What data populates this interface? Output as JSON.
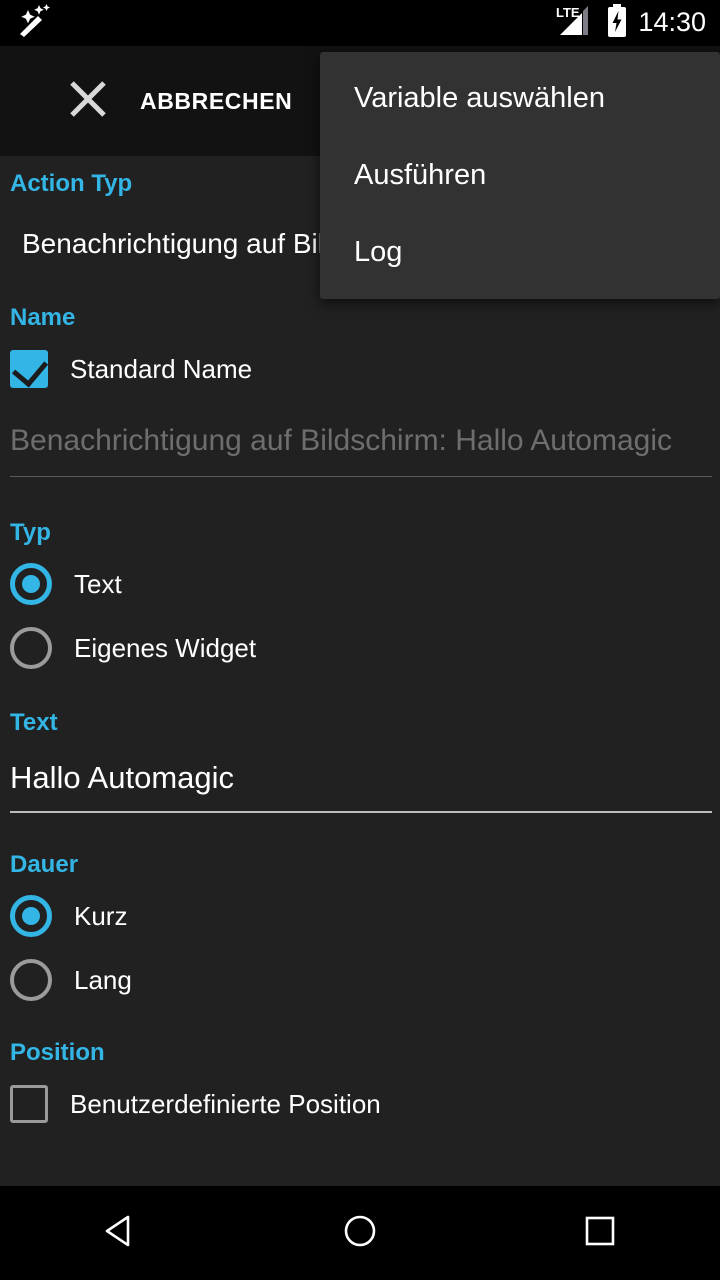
{
  "status_bar": {
    "app_icon": "magic-wand-icon",
    "network_label": "LTE",
    "battery_icon": "battery-charging-icon",
    "signal_icon": "signal-bars-icon",
    "clock": "14:30"
  },
  "action_bar": {
    "close_icon": "close-icon",
    "title": "ABBRECHEN"
  },
  "overflow_menu": {
    "visible": true,
    "items": [
      {
        "label": "Variable auswählen"
      },
      {
        "label": "Ausführen"
      },
      {
        "label": "Log"
      }
    ]
  },
  "form": {
    "action_type": {
      "label": "Action Typ",
      "value": "Benachrichtigung auf Bildschirm"
    },
    "name": {
      "label": "Name",
      "checkbox_label": "Standard Name",
      "checkbox_checked": true,
      "field_value": "Benachrichtigung auf Bildschirm: Hallo Automagic",
      "field_enabled": false
    },
    "typ": {
      "label": "Typ",
      "options": [
        {
          "label": "Text",
          "selected": true
        },
        {
          "label": "Eigenes Widget",
          "selected": false
        }
      ]
    },
    "text": {
      "label": "Text",
      "value": "Hallo Automagic"
    },
    "dauer": {
      "label": "Dauer",
      "options": [
        {
          "label": "Kurz",
          "selected": true
        },
        {
          "label": "Lang",
          "selected": false
        }
      ]
    },
    "position": {
      "label": "Position",
      "checkbox_label": "Benutzerdefinierte Position",
      "checkbox_checked": false
    }
  },
  "nav_bar": {
    "back": "back-triangle-icon",
    "home": "home-circle-icon",
    "recents": "recents-square-icon"
  },
  "colors": {
    "accent": "#33b5e5",
    "background": "#212121",
    "action_bar": "#121212",
    "menu": "#323232",
    "disabled_text": "#6e6e6e"
  }
}
